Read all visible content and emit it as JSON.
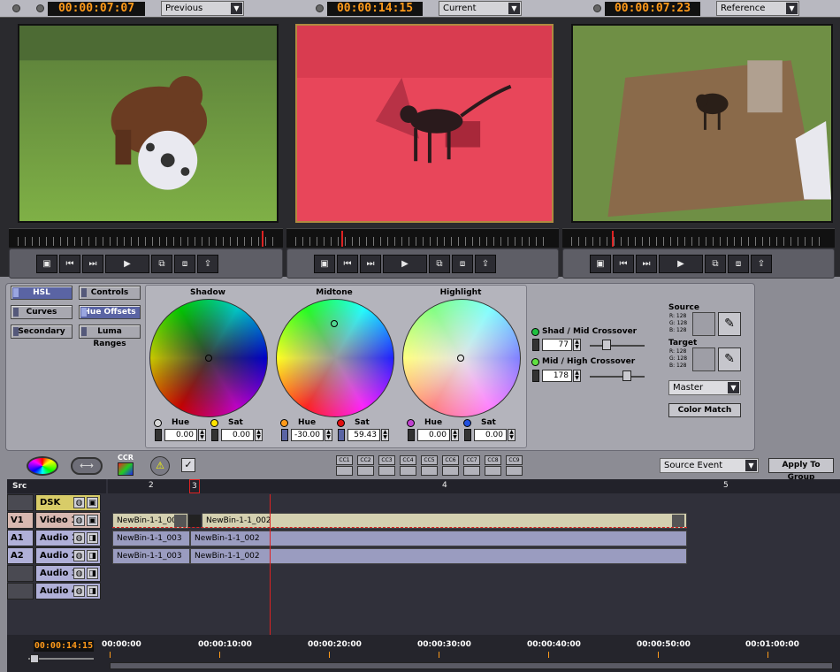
{
  "monitors": [
    {
      "timecode": "00:00:07:07",
      "label": "Previous"
    },
    {
      "timecode": "00:00:14:15",
      "label": "Current"
    },
    {
      "timecode": "00:00:07:23",
      "label": "Reference"
    }
  ],
  "hsl_tabs": {
    "hsl": "HSL",
    "curves": "Curves",
    "secondary": "Secondary"
  },
  "sub_tabs": {
    "controls": "Controls",
    "hue_offsets": "Hue Offsets",
    "luma_ranges": "Luma Ranges"
  },
  "wheels": [
    {
      "title": "Shadow",
      "hue_label": "Hue",
      "hue": "0.00",
      "sat_label": "Sat",
      "sat": "0.00",
      "hue_color": "#d8d8d8",
      "sat_color": "#ffe300"
    },
    {
      "title": "Midtone",
      "hue_label": "Hue",
      "hue": "-30.00",
      "sat_label": "Sat",
      "sat": "59.43",
      "hue_color": "#ff9a1a",
      "sat_color": "#e01010"
    },
    {
      "title": "Highlight",
      "hue_label": "Hue",
      "hue": "0.00",
      "sat_label": "Sat",
      "sat": "0.00",
      "hue_color": "#c040d0",
      "sat_color": "#2050e0"
    }
  ],
  "crossover": {
    "shad_mid_label": "Shad / Mid Crossover",
    "shad_mid_value": "77",
    "mid_high_label": "Mid / High Crossover",
    "mid_high_value": "178"
  },
  "source": {
    "title": "Source",
    "r": "R: 128",
    "g": "G: 128",
    "b": "B: 128"
  },
  "target": {
    "title": "Target",
    "r": "R: 128",
    "g": "G: 128",
    "b": "B: 128"
  },
  "master_select": "Master",
  "color_match_label": "Color Match",
  "toolbar": {
    "ccr_label": "CCR",
    "cc_buttons": [
      "CC1",
      "CC2",
      "CC3",
      "CC4",
      "CC5",
      "CC6",
      "CC7",
      "CC8",
      "CC9"
    ],
    "source_event": "Source Event",
    "apply_to_group": "Apply To Group"
  },
  "timeline": {
    "src_label": "Src",
    "segments": [
      "2",
      "3",
      "4",
      "5"
    ],
    "tracks": [
      {
        "id": "",
        "name": "DSK"
      },
      {
        "id": "V1",
        "name": "Video 1"
      },
      {
        "id": "A1",
        "name": "Audio 1"
      },
      {
        "id": "A2",
        "name": "Audio 2"
      },
      {
        "id": "",
        "name": "Audio 3"
      },
      {
        "id": "",
        "name": "Audio 4"
      }
    ],
    "clips": {
      "v1_a": "NewBin-1-1_00",
      "v1_b": "NewBin-1-1_002",
      "a1_a": "NewBin-1-1_003",
      "a1_b": "NewBin-1-1_002",
      "a2_a": "NewBin-1-1_003",
      "a2_b": "NewBin-1-1_002"
    },
    "current_timecode": "00:00:14:15",
    "ruler_labels": [
      "00:00:00",
      "00:00:10:00",
      "00:00:20:00",
      "00:00:30:00",
      "00:00:40:00",
      "00:00:50:00",
      "00:01:00:00"
    ]
  },
  "colors": {
    "timecode": "#ff9a1a",
    "playhead": "#dd2222",
    "selected_tab": "#5a64a4"
  }
}
